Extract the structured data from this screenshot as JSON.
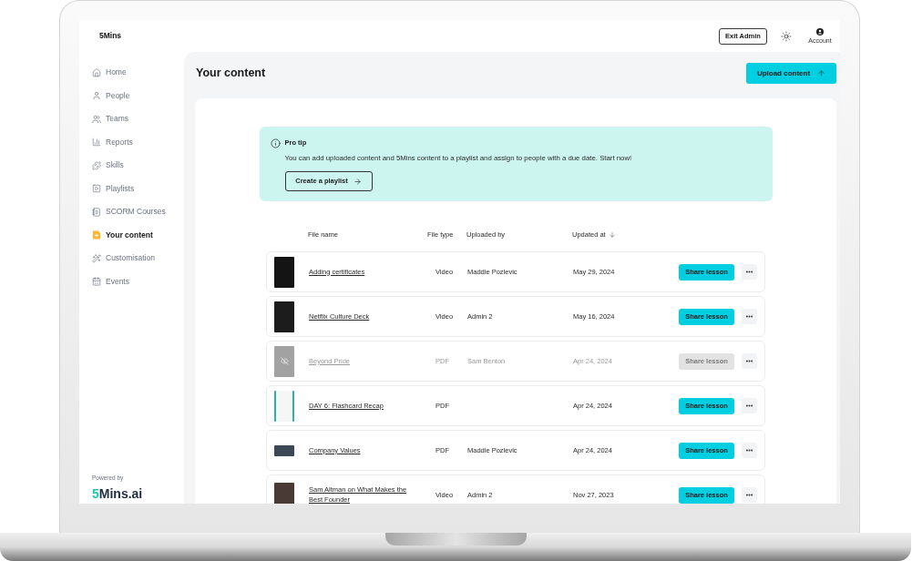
{
  "app": {
    "logo": "5Mins"
  },
  "header": {
    "exit_button": "Exit Admin",
    "account_label": "Account"
  },
  "sidebar": {
    "items": [
      {
        "label": "Home",
        "selected": false
      },
      {
        "label": "People",
        "selected": false
      },
      {
        "label": "Teams",
        "selected": false
      },
      {
        "label": "Reports",
        "selected": false
      },
      {
        "label": "Skills",
        "selected": false
      },
      {
        "label": "Playlists",
        "selected": false
      },
      {
        "label": "SCORM Courses",
        "selected": false
      },
      {
        "label": "Your content",
        "selected": true
      },
      {
        "label": "Customisation",
        "selected": false
      },
      {
        "label": "Events",
        "selected": false
      }
    ],
    "powered_by": "Powered by",
    "brand": {
      "accent": "5",
      "rest": "Mins.ai"
    }
  },
  "content": {
    "title": "Your content",
    "upload_button": "Upload content"
  },
  "tip": {
    "title": "Pro tip",
    "text": "You can add uploaded content and 5Mins content to a playlist and assign to people with a due date. Start now!",
    "button": "Create a playlist"
  },
  "table": {
    "columns": [
      {
        "label": "File name",
        "sorted": false
      },
      {
        "label": "File type",
        "sorted": false
      },
      {
        "label": "Uploaded by",
        "sorted": false
      },
      {
        "label": "Updated at",
        "sorted": true
      }
    ],
    "rows": [
      {
        "name": "Adding certificates",
        "file_type": "Video",
        "uploaded_by": "Maddie Pozlevic",
        "updated_at": "May 29, 2024",
        "action": "Share lesson",
        "disabled": false
      },
      {
        "name": "Netflix Culture Deck",
        "file_type": "Video",
        "uploaded_by": "Admin 2",
        "updated_at": "May 16, 2024",
        "action": "Share lesson",
        "disabled": false
      },
      {
        "name": "Beyond Pride",
        "file_type": "PDF",
        "uploaded_by": "Sam Benton",
        "updated_at": "Apr 24, 2024",
        "action": "Share lesson",
        "disabled": true
      },
      {
        "name": "DAY 6: Flashcard Recap",
        "file_type": "PDF",
        "updated_at": "Apr 24, 2024",
        "action": "Share lesson",
        "disabled": false
      },
      {
        "name": "Company Values",
        "file_type": "PDF",
        "uploaded_by": "Maddie Pozlevic",
        "updated_at": "Apr 24, 2024",
        "action": "Share lesson",
        "disabled": false
      },
      {
        "name": "Sam Altman on What Makes the Best Founder",
        "file_type": "Video",
        "uploaded_by": "Admin 2",
        "updated_at": "Nov 27, 2023",
        "action": "Share lesson",
        "disabled": false
      }
    ]
  }
}
